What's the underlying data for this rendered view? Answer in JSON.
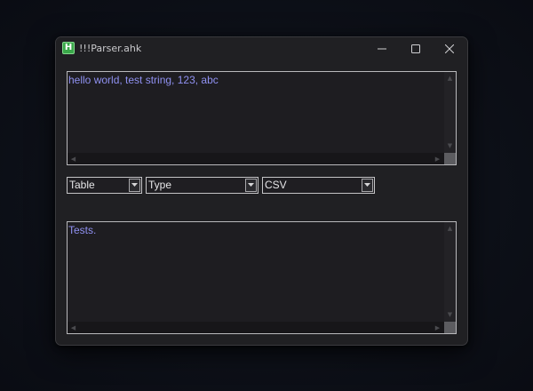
{
  "window": {
    "title": "!!!Parser.ahk",
    "icon_letter": "H"
  },
  "caption_buttons": {
    "minimize_icon": "minimize-icon",
    "maximize_icon": "maximize-icon",
    "close_icon": "close-icon"
  },
  "input": {
    "value": "hello world, test string, 123, abc"
  },
  "dropdowns": [
    {
      "selected": "Table"
    },
    {
      "selected": "Type"
    },
    {
      "selected": "CSV"
    }
  ],
  "output": {
    "value": "Tests."
  },
  "colors": {
    "window_bg": "#202023",
    "edit_text": "#8f90f0",
    "app_icon": "#3aa84a"
  }
}
